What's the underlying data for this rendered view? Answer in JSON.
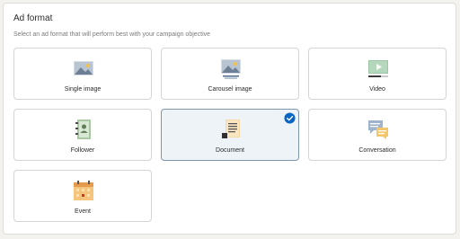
{
  "header": {
    "title": "Ad format",
    "subtitle": "Select an ad format that will perform best with your campaign objective"
  },
  "formats": [
    {
      "label": "Single image",
      "icon": "single-image-icon",
      "selected": false
    },
    {
      "label": "Carousel image",
      "icon": "carousel-image-icon",
      "selected": false
    },
    {
      "label": "Video",
      "icon": "video-icon",
      "selected": false
    },
    {
      "label": "Follower",
      "icon": "follower-icon",
      "selected": false
    },
    {
      "label": "Document",
      "icon": "document-icon",
      "selected": true
    },
    {
      "label": "Conversation",
      "icon": "conversation-icon",
      "selected": false
    },
    {
      "label": "Event",
      "icon": "event-icon",
      "selected": false
    }
  ],
  "colors": {
    "selected_border": "#7b96ad",
    "selected_bg": "#eef3f8",
    "check": "#0a66c2"
  }
}
